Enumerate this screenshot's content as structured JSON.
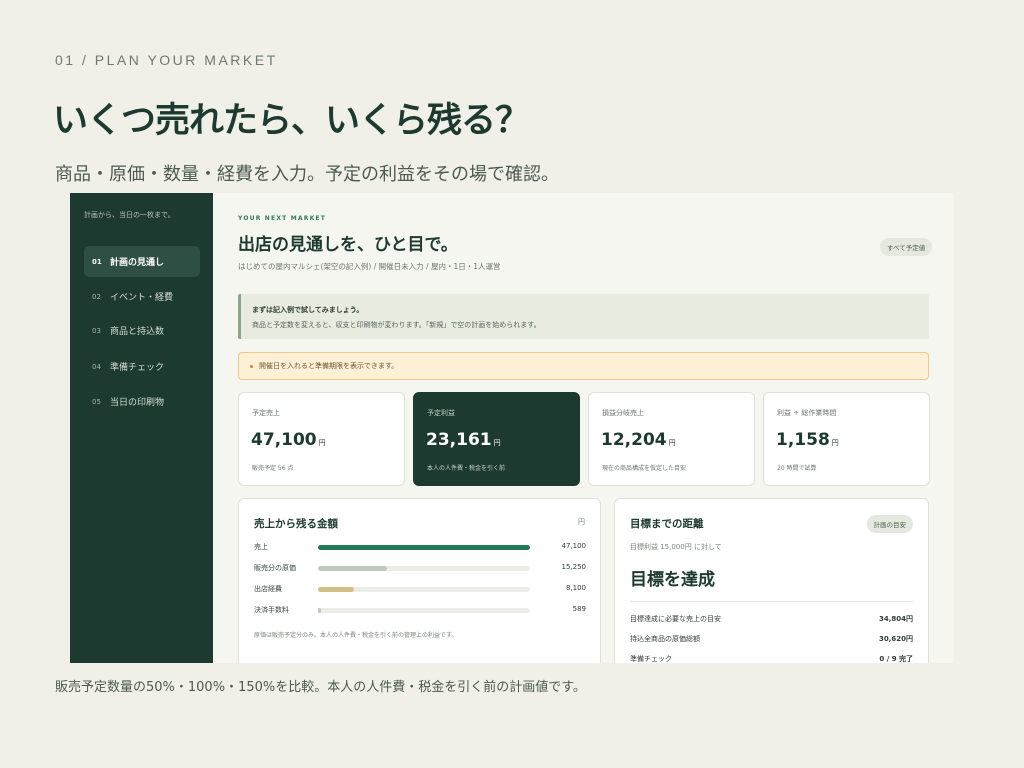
{
  "page": {
    "eyebrow": "01 / PLAN YOUR MARKET",
    "headline": "いくつ売れたら、いくら残る？",
    "subhead": "商品・原価・数量・経費を入力。予定の利益をその場で確認。",
    "caption": "販売予定数量の50%・100%・150%を比較。本人の人件費・税金を引く前の計画値です。"
  },
  "sidebar": {
    "tagline": "計画から、当日の一枚まで。",
    "items": [
      {
        "num": "01",
        "label": "計画の見通し"
      },
      {
        "num": "02",
        "label": "イベント・経費"
      },
      {
        "num": "03",
        "label": "商品と持込数"
      },
      {
        "num": "04",
        "label": "準備チェック"
      },
      {
        "num": "05",
        "label": "当日の印刷物"
      }
    ]
  },
  "main": {
    "kicker": "YOUR NEXT MARKET",
    "title": "出店の見通しを、ひと目で。",
    "meta": "はじめての屋内マルシェ(架空の記入例) / 開催日未入力 / 屋内・1日・1人運営",
    "badge": "すべて予定値",
    "info_title": "まずは記入例で試してみましょう。",
    "info_body": "商品と予定数を変えると、収支と印刷物が変わります。「新規」で空の計画を始められます。",
    "warning": "開催日を入れると準備期限を表示できます。"
  },
  "kpis": [
    {
      "label": "予定売上",
      "value": "47,100",
      "unit": "円",
      "note": "販売予定 56 点"
    },
    {
      "label": "予定利益",
      "value": "23,161",
      "unit": "円",
      "note": "本人の人件費・税金を引く前"
    },
    {
      "label": "損益分岐売上",
      "value": "12,204",
      "unit": "円",
      "note": "現在の商品構成を仮定した目安"
    },
    {
      "label": "利益 ÷ 総作業時間",
      "value": "1,158",
      "unit": "円",
      "note": "20 時間で試算"
    }
  ],
  "breakdown": {
    "title": "売上から残る金額",
    "unit": "円",
    "footnote": "原価は販売予定分のみ。本人の人件費・税金を引く前の管理上の利益です。",
    "rows": [
      {
        "label": "売上",
        "value": "47,100",
        "ratio": 1.0,
        "color": "#1f7a55"
      },
      {
        "label": "販売分の原価",
        "value": "15,250",
        "ratio": 0.324,
        "color": "#c3c8bd"
      },
      {
        "label": "出店経費",
        "value": "8,100",
        "ratio": 0.172,
        "color": "#d3bf86"
      },
      {
        "label": "決済手数料",
        "value": "589",
        "ratio": 0.0125,
        "color": "#c3c8bd"
      }
    ]
  },
  "goal": {
    "title": "目標までの距離",
    "badge": "計画の目安",
    "sub": "目標利益 15,000円 に対して",
    "status": "目標を達成",
    "rows": [
      {
        "label": "目標達成に必要な売上の目安",
        "value": "34,804円"
      },
      {
        "label": "持込全商品の原価総額",
        "value": "30,620円"
      },
      {
        "label": "準備チェック",
        "value": "0 / 9 完了"
      }
    ]
  }
}
